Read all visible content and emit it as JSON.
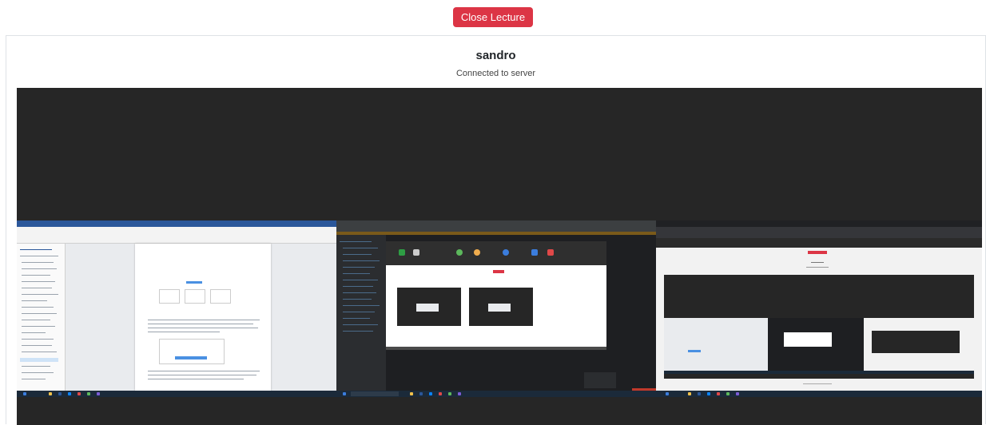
{
  "header": {
    "close_button_label": "Close Lecture"
  },
  "lecture": {
    "presenter_name": "sandro",
    "connection_status": "Connected to server"
  },
  "colors": {
    "danger": "#dc3545",
    "video_background": "#262626",
    "card_border": "#dee2e6"
  }
}
